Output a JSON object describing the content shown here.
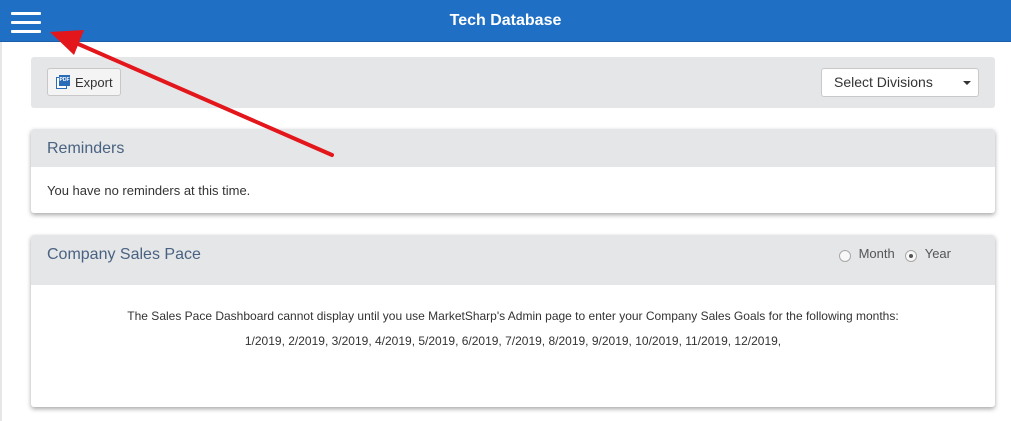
{
  "header": {
    "title": "Tech Database",
    "menu_icon": "hamburger-menu-icon",
    "background": "#1f6fc5"
  },
  "toolbar": {
    "export_label": "Export",
    "export_icon": "pdf-icon",
    "pdf_icon_text": "PDF",
    "divisions_select": "Select Divisions"
  },
  "reminders": {
    "title": "Reminders",
    "body": "You have no reminders at this time."
  },
  "sales_pace": {
    "title": "Company Sales Pace",
    "radio_month": "Month",
    "radio_year": "Year",
    "selected": "Year",
    "message": "The Sales Pace Dashboard cannot display until you use MarketSharp's Admin page to enter your Company Sales Goals for the following months:",
    "months": "1/2019, 2/2019, 3/2019, 4/2019, 5/2019, 6/2019, 7/2019, 8/2019, 9/2019, 10/2019, 11/2019, 12/2019,"
  },
  "annotation": {
    "arrow_color": "#e3161b"
  }
}
